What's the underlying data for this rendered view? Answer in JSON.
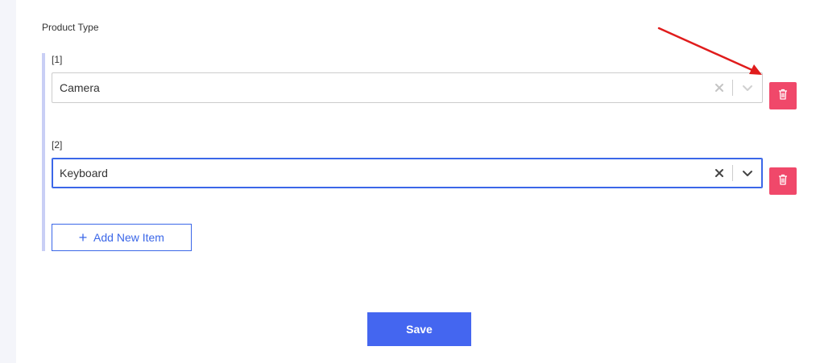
{
  "form": {
    "section_label": "Product Type",
    "items": [
      {
        "index_label": "[1]",
        "value": "Camera",
        "focused": false
      },
      {
        "index_label": "[2]",
        "value": "Keyboard",
        "focused": true
      }
    ],
    "add_item_label": "Add New Item",
    "add_item_icon": "plus-icon",
    "save_label": "Save"
  },
  "icons": {
    "clear": "close-icon",
    "dropdown": "chevron-down-icon",
    "delete": "trash-icon"
  },
  "colors": {
    "accent": "#4466f0",
    "focus_border": "#3b67e8",
    "delete_button": "#f0486a",
    "rail": "#c9cff5",
    "annotation_arrow": "#e01c1c"
  }
}
